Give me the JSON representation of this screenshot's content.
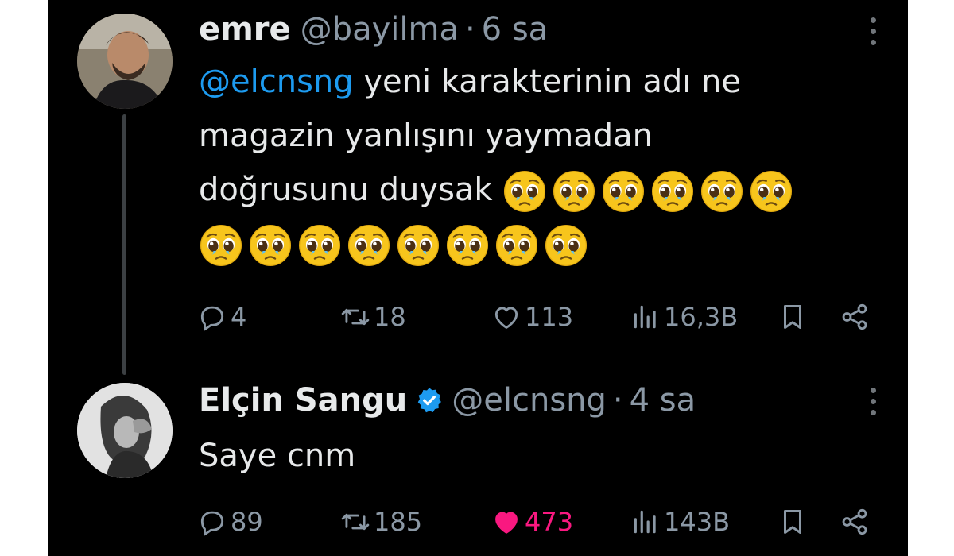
{
  "colors": {
    "background": "#000000",
    "text": "#e7e9ea",
    "muted": "#8b98a5",
    "mention": "#1d9bf0",
    "like_active": "#f91880",
    "verified": "#1d9bf0",
    "thread_line": "#3c4043"
  },
  "tweets": [
    {
      "display_name": "emre",
      "handle": "@bayilma",
      "separator": "·",
      "time": "6 sa",
      "verified": false,
      "mention": "@elcnsng",
      "text_line1": "yeni karakterinin adı ne",
      "text_line2": "magazin yanlışını yaymadan",
      "text_line3": "doğrusunu duysak",
      "emoji": "pleading-face",
      "emoji_count": 14,
      "actions": {
        "replies": "4",
        "retweets": "18",
        "likes": "113",
        "views": "16,3B",
        "liked": false
      }
    },
    {
      "display_name": "Elçin Sangu",
      "handle": "@elcnsng",
      "separator": "·",
      "time": "4 sa",
      "verified": true,
      "text": "Saye cnm",
      "actions": {
        "replies": "89",
        "retweets": "185",
        "likes": "473",
        "views": "143B",
        "liked": true
      }
    }
  ],
  "icons": [
    "reply-icon",
    "retweet-icon",
    "like-icon",
    "views-icon",
    "bookmark-icon",
    "share-icon",
    "more-icon",
    "verified-badge-icon"
  ]
}
